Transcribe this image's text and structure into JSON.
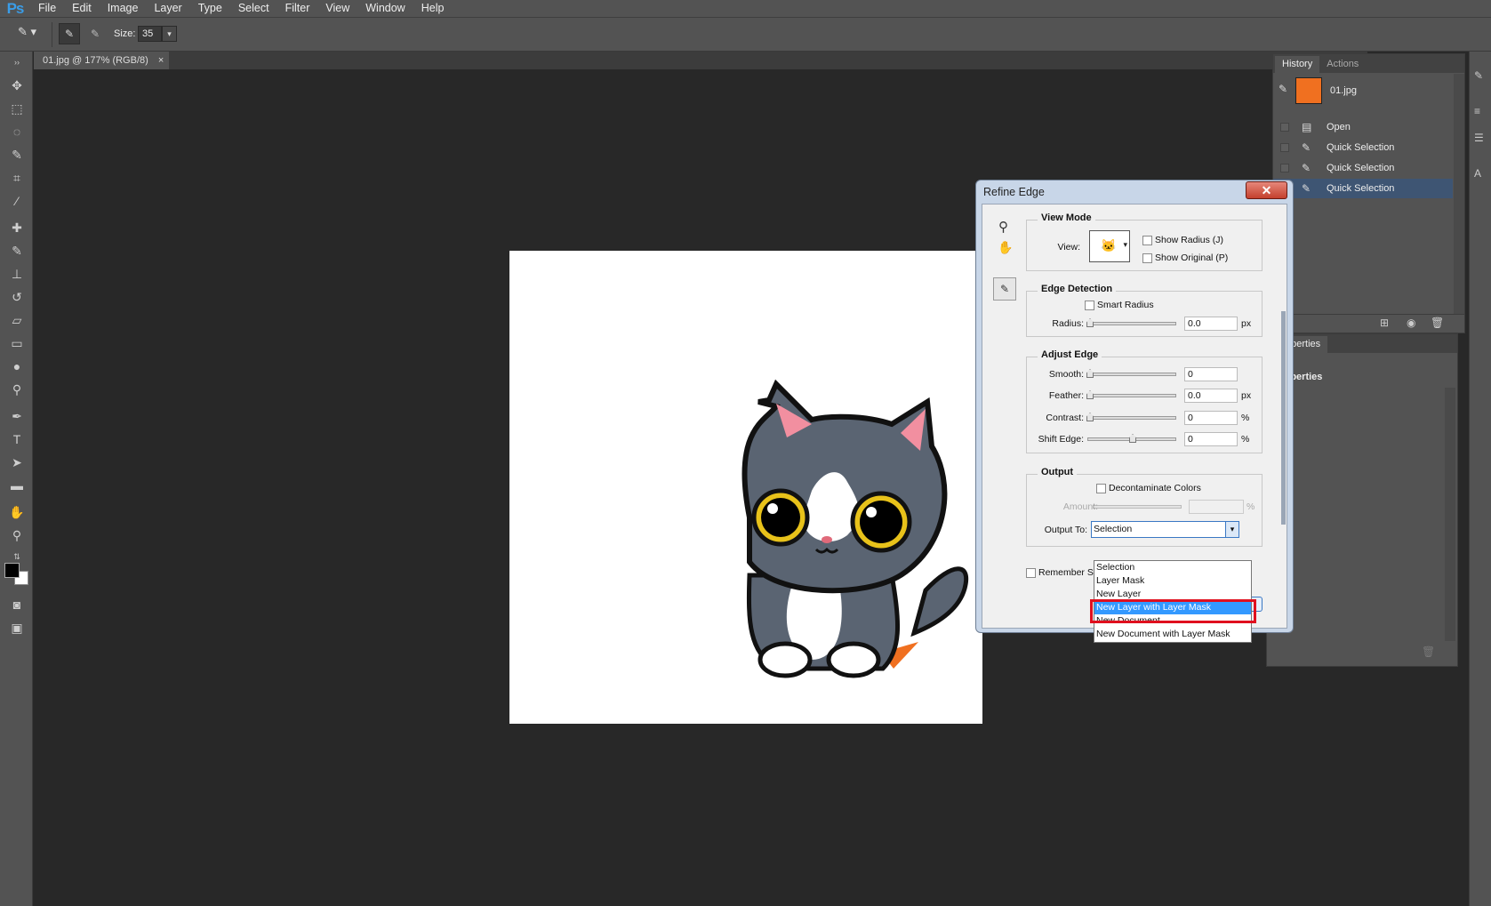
{
  "menubar": {
    "logo": "Ps",
    "items": [
      "File",
      "Edit",
      "Image",
      "Layer",
      "Type",
      "Select",
      "Filter",
      "View",
      "Window",
      "Help"
    ]
  },
  "options": {
    "size_label": "Size:",
    "size_value": "35"
  },
  "document": {
    "tab_title": "01.jpg @ 177% (RGB/8)",
    "close": "×"
  },
  "history": {
    "tabs": [
      "History",
      "Actions"
    ],
    "snapshot": "01.jpg",
    "items": [
      "Open",
      "Quick Selection",
      "Quick Selection",
      "Quick Selection"
    ]
  },
  "properties": {
    "tab": "Properties",
    "title": "Properties"
  },
  "dialog": {
    "title": "Refine Edge",
    "close": "✕",
    "view_mode": {
      "title": "View Mode",
      "view_label": "View:",
      "show_radius": "Show Radius (J)",
      "show_original": "Show Original (P)"
    },
    "edge_detection": {
      "title": "Edge Detection",
      "smart_radius": "Smart Radius",
      "radius_label": "Radius:",
      "radius_value": "0.0",
      "radius_unit": "px"
    },
    "adjust_edge": {
      "title": "Adjust Edge",
      "smooth_label": "Smooth:",
      "smooth_value": "0",
      "feather_label": "Feather:",
      "feather_value": "0.0",
      "feather_unit": "px",
      "contrast_label": "Contrast:",
      "contrast_value": "0",
      "contrast_unit": "%",
      "shift_label": "Shift Edge:",
      "shift_value": "0",
      "shift_unit": "%"
    },
    "output": {
      "title": "Output",
      "decontaminate": "Decontaminate Colors",
      "amount_label": "Amount:",
      "amount_unit": "%",
      "output_to_label": "Output To:",
      "output_to_value": "Selection"
    },
    "remember": "Remember Se"
  },
  "dropdown": {
    "options": [
      "Selection",
      "Layer Mask",
      "New Layer",
      "New Layer with Layer Mask",
      "New Document",
      "New Document with Layer Mask"
    ],
    "highlighted": "New Layer with Layer Mask"
  },
  "colors": {
    "accent_highlight": "#3399ff",
    "annotation_box": "#e0101e",
    "history_selected": "#3e5573"
  }
}
